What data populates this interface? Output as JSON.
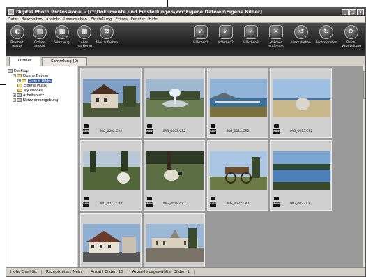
{
  "window": {
    "title": "Digital Photo Professional - [C:\\Dokumente und Einstellungen\\xxx\\Eigene Dateien\\Eigene Bilder]",
    "controls": [
      "_",
      "□",
      "×"
    ]
  },
  "menu": [
    "Datei",
    "Bearbeiten",
    "Ansicht",
    "Lesezeichen",
    "Einstellung",
    "Extras",
    "Fenster",
    "Hilfe"
  ],
  "toolbar": {
    "left": [
      {
        "label": "Bearbeit. fenster",
        "icon": "edit-window-icon",
        "glyph": "◐"
      },
      {
        "label": "Ordner- ansicht",
        "icon": "folder-view-icon",
        "glyph": "▤"
      },
      {
        "label": "Werkzeug",
        "icon": "tool-palette-icon",
        "glyph": "▦"
      },
      {
        "label": "Alles markieren",
        "icon": "select-all-icon",
        "glyph": "▦"
      },
      {
        "label": "Alles aufheben",
        "icon": "deselect-all-icon",
        "glyph": "⊠"
      }
    ],
    "right": [
      {
        "label": "Häkchen1",
        "icon": "check-mark-1-icon",
        "glyph": "✓"
      },
      {
        "label": "Häkchen2",
        "icon": "check-mark-2-icon",
        "glyph": "✓"
      },
      {
        "label": "Häkchen3",
        "icon": "check-mark-3-icon",
        "glyph": "✓"
      },
      {
        "label": "Häkchen entfernen",
        "icon": "remove-check-icon",
        "glyph": "✕"
      },
      {
        "label": "Links drehen",
        "icon": "rotate-left-icon",
        "glyph": "↺"
      },
      {
        "label": "Rechts drehen",
        "icon": "rotate-right-icon",
        "glyph": "↻"
      },
      {
        "label": "Batch- Verarbeitung",
        "icon": "batch-process-icon",
        "glyph": "⟳"
      }
    ]
  },
  "tabs": [
    {
      "label": "Ordner",
      "active": true
    },
    {
      "label": "Sammlung (0)",
      "active": false
    }
  ],
  "tree": [
    {
      "label": "Desktop",
      "level": 0,
      "expander": "",
      "kind": "drive"
    },
    {
      "label": "Eigene Dateien",
      "level": 1,
      "expander": "−",
      "kind": "folder"
    },
    {
      "label": "Eigene Bilder",
      "level": 2,
      "expander": "+",
      "kind": "folder",
      "selected": true
    },
    {
      "label": "Eigene Musik",
      "level": 2,
      "expander": "",
      "kind": "folder"
    },
    {
      "label": "My eBooks",
      "level": 2,
      "expander": "",
      "kind": "folder"
    },
    {
      "label": "Arbeitsplatz",
      "level": 1,
      "expander": "+",
      "kind": "drive"
    },
    {
      "label": "Netzwerkumgebung",
      "level": 1,
      "expander": "+",
      "kind": "drive"
    }
  ],
  "thumbnails": [
    {
      "name": "IMG_0002.CR2",
      "selected": true,
      "scene": "house",
      "raw_label": "RAW"
    },
    {
      "name": "IMG_0003.CR2",
      "selected": true,
      "scene": "fountain",
      "raw_label": "RAW"
    },
    {
      "name": "IMG_0013.CR2",
      "selected": true,
      "scene": "sea",
      "raw_label": "RAW"
    },
    {
      "name": "IMG_0015.CR2",
      "selected": true,
      "scene": "rock",
      "raw_label": "RAW"
    },
    {
      "name": "IMG_0017.CR2",
      "selected": true,
      "scene": "rock2",
      "raw_label": "RAW"
    },
    {
      "name": "IMG_0019.CR2",
      "selected": true,
      "scene": "sheep",
      "raw_label": "RAW"
    },
    {
      "name": "IMG_0022.CR2",
      "selected": true,
      "scene": "cart",
      "raw_label": "RAW"
    },
    {
      "name": "IMG_0023.CR2",
      "selected": true,
      "scene": "lake",
      "raw_label": "RAW"
    },
    {
      "name": "",
      "selected": true,
      "scene": "building",
      "raw_label": "RAW"
    },
    {
      "name": "",
      "selected": true,
      "scene": "palace",
      "raw_label": "RAW"
    }
  ],
  "status": [
    "Hohe Qualität",
    "Rezeptdaten: Nein",
    "Anzahl Bilder: 10",
    "Anzahl ausgewählter Bilder: 1"
  ],
  "colors": {
    "toolbar": "#2a2a2a",
    "selection": "#3a5fa8",
    "grid_bg": "#9a9a9a"
  }
}
